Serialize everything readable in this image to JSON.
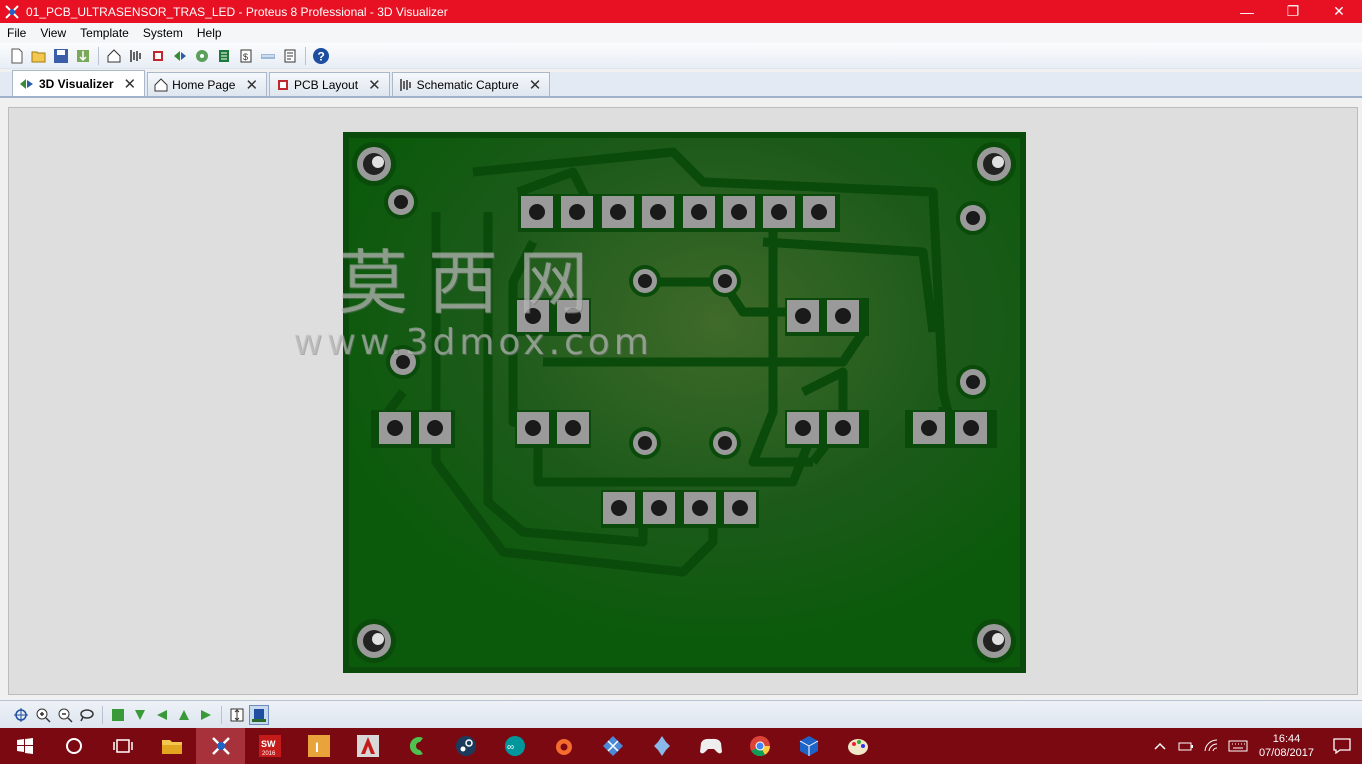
{
  "window": {
    "title": "01_PCB_ULTRASENSOR_TRAS_LED - Proteus 8 Professional - 3D Visualizer",
    "minimize": "—",
    "restore": "❐",
    "close": "✕"
  },
  "menu": [
    "File",
    "View",
    "Template",
    "System",
    "Help"
  ],
  "tabs": [
    {
      "label": "3D Visualizer",
      "active": true
    },
    {
      "label": "Home Page",
      "active": false
    },
    {
      "label": "PCB Layout",
      "active": false
    },
    {
      "label": "Schematic Capture",
      "active": false
    }
  ],
  "tab_close": "✕",
  "watermark": {
    "cn": "莫西网",
    "url": "www.3dmox.com"
  },
  "clock": {
    "time": "16:44",
    "date": "07/08/2017"
  },
  "taskbar_icons": [
    "windows-start",
    "cortana",
    "task-view",
    "file-explorer",
    "proteus",
    "solidworks-2016",
    "inventor",
    "autocad",
    "cura",
    "steam",
    "arduino",
    "origin",
    "network-app",
    "game-app",
    "gamepad-app",
    "chrome",
    "virtualbox",
    "paint-app"
  ],
  "colors": {
    "titlebar": "#e81123",
    "taskbar": "#7a0912",
    "pcb_green": "#0b5a0b",
    "pcb_border": "#0a4a0a",
    "pad": "#9a9a9a"
  }
}
